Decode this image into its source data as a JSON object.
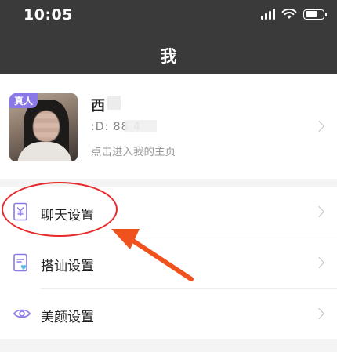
{
  "status_bar": {
    "time": "10:05"
  },
  "header": {
    "title": "我"
  },
  "profile": {
    "badge": "真人",
    "name": "西",
    "id_text": ":D: 88    4",
    "hint": "点击进入我的主页"
  },
  "menu": {
    "items": [
      {
        "label": "聊天设置",
        "icon": "yuan-document-icon"
      },
      {
        "label": "搭讪设置",
        "icon": "heart-card-icon"
      },
      {
        "label": "美颜设置",
        "icon": "eye-icon"
      }
    ]
  },
  "colors": {
    "header_bg": "#3a3a3a",
    "badge": "#8a78e6",
    "icon_accent": "#8a78e6",
    "annotation": "#e8282a"
  }
}
